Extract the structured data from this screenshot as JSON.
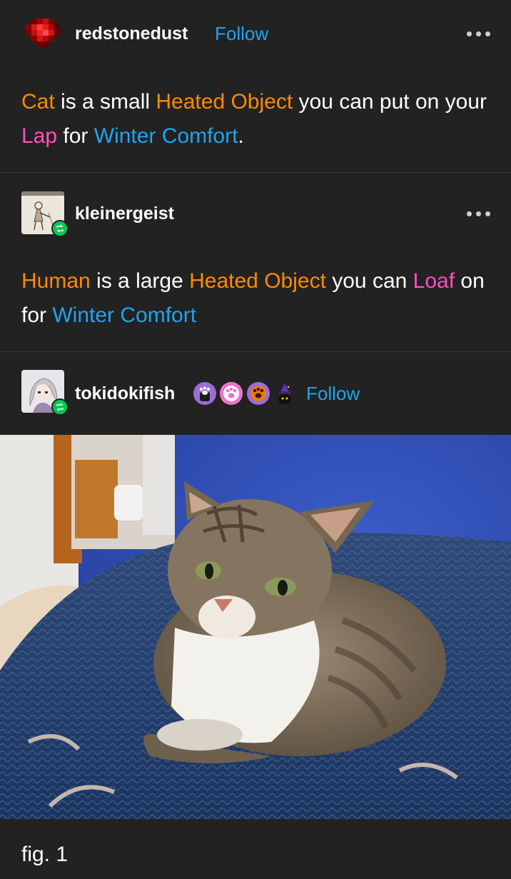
{
  "posts": [
    {
      "username": "redstonedust",
      "follow_label": "Follow",
      "avatar_icon": "red-gem-pixel-avatar",
      "more_icon": "more-options-icon",
      "segments": [
        {
          "t": "Cat",
          "c": "o"
        },
        {
          "t": " is a small ",
          "c": ""
        },
        {
          "t": "Heated Object",
          "c": "o"
        },
        {
          "t": " you can put on your ",
          "c": ""
        },
        {
          "t": "Lap",
          "c": "p"
        },
        {
          "t": " for ",
          "c": ""
        },
        {
          "t": "Winter Comfort",
          "c": "b"
        },
        {
          "t": ".",
          "c": ""
        }
      ]
    },
    {
      "username": "kleinergeist",
      "avatar_icon": "sketch-drawing-avatar",
      "reblog_icon": "reblog-icon",
      "more_icon": "more-options-icon",
      "segments": [
        {
          "t": "Human",
          "c": "o"
        },
        {
          "t": " is a large ",
          "c": ""
        },
        {
          "t": "Heated Object",
          "c": "o"
        },
        {
          "t": " you can ",
          "c": ""
        },
        {
          "t": "Loaf",
          "c": "p"
        },
        {
          "t": " on for ",
          "c": ""
        },
        {
          "t": "Winter Comfort",
          "c": "b"
        }
      ]
    },
    {
      "username": "tokidokifish",
      "follow_label": "Follow",
      "avatar_icon": "anime-character-avatar",
      "reblog_icon": "reblog-icon",
      "badge_icons": [
        "paw-badge-purple-icon",
        "paw-badge-pink-icon",
        "paw-badge-orange-icon",
        "witch-cat-badge-icon"
      ],
      "image_description": "tabby-cat-loafing-on-blue-crochet-blanket",
      "caption": "fig. 1"
    }
  ],
  "colors": {
    "background": "#222222",
    "orange": "#ff8a00",
    "pink": "#ff4fc0",
    "blue": "#1ea4ef",
    "reblog_green": "#00c853"
  }
}
